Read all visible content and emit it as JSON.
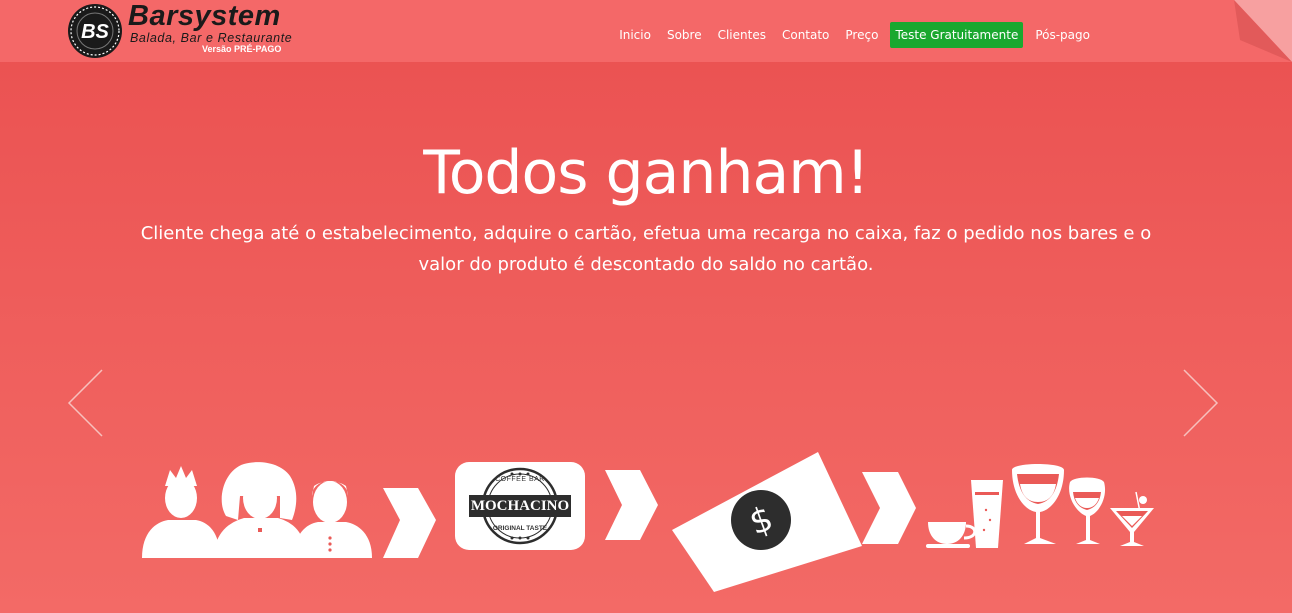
{
  "brand": {
    "badge": "BS",
    "name": "Barsystem",
    "tagline": "Balada, Bar e Restaurante",
    "version": "Versão PRÉ-PAGO"
  },
  "nav": {
    "items": [
      "Inicio",
      "Sobre",
      "Clientes",
      "Contato",
      "Preço"
    ],
    "cta": "Teste Gratuitamente",
    "last": "Pós-pago"
  },
  "hero": {
    "title": "Todos ganham!",
    "text": "Cliente chega até o estabelecimento, adquire o cartão, efetua uma recarga no caixa, faz o pedido nos bares e o valor do produto é descontado do saldo no cartão."
  },
  "illustration": {
    "coffee_bar": "COFFEE BAR",
    "shop_name": "MOCHACINO",
    "original_taste": "ORIGINAL TASTE",
    "money_symbol": "$"
  },
  "colors": {
    "background_top": "#ea5050",
    "navbar": "#f46868",
    "cta": "#1aa82f",
    "text": "#ffffff"
  },
  "icons": {
    "prev": "chevron-left-icon",
    "next": "chevron-right-icon",
    "step": "step-arrow-icon",
    "people": "people-icon",
    "money": "money-bill-icon",
    "drinks": "drinks-icon"
  }
}
